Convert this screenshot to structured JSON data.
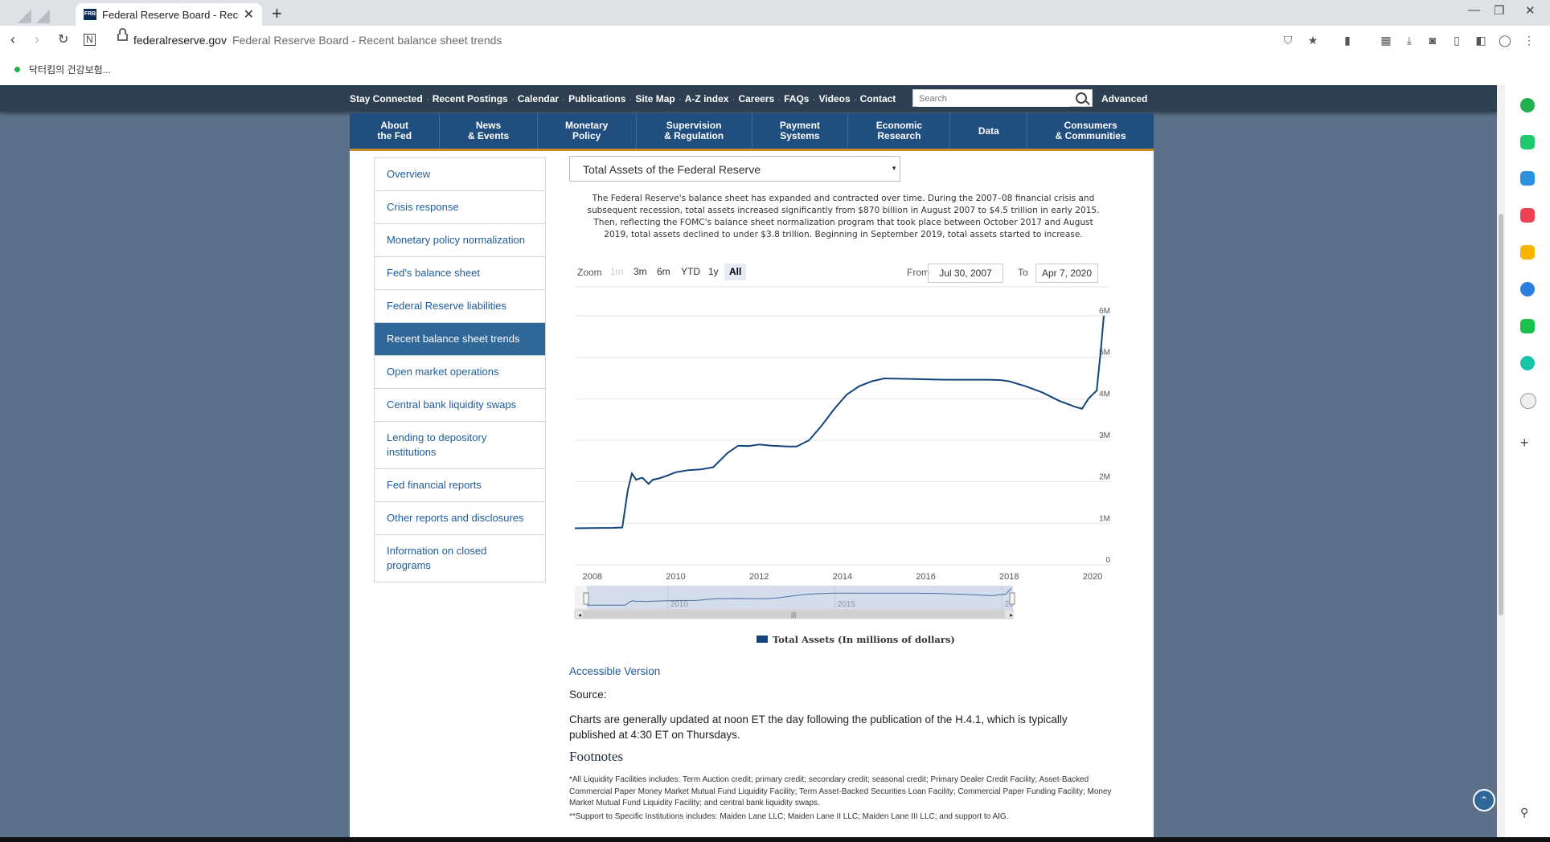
{
  "browser": {
    "tab_title": "Federal Reserve Board - Recent",
    "favicon_text": "FRB",
    "url_host": "federalreserve.gov",
    "url_page_title": "Federal Reserve Board - Recent balance sheet trends",
    "bookmark": "닥터킴의 건강보험..."
  },
  "util_nav": {
    "links": [
      "Stay Connected",
      "Recent Postings",
      "Calendar",
      "Publications",
      "Site Map",
      "A-Z index",
      "Careers",
      "FAQs",
      "Videos",
      "Contact"
    ],
    "search_placeholder": "Search",
    "advanced": "Advanced"
  },
  "main_nav": [
    {
      "line1": "About",
      "line2": "the Fed"
    },
    {
      "line1": "News",
      "line2": "& Events"
    },
    {
      "line1": "Monetary",
      "line2": "Policy"
    },
    {
      "line1": "Supervision",
      "line2": "& Regulation"
    },
    {
      "line1": "Payment",
      "line2": "Systems"
    },
    {
      "line1": "Economic",
      "line2": "Research"
    },
    {
      "line1": "Data",
      "line2": ""
    },
    {
      "line1": "Consumers",
      "line2": "& Communities"
    }
  ],
  "sidebar": [
    "Overview",
    "Crisis response",
    "Monetary policy normalization",
    "Fed's balance sheet",
    "Federal Reserve liabilities",
    "Recent balance sheet trends",
    "Open market operations",
    "Central bank liquidity swaps",
    "Lending to depository institutions",
    "Fed financial reports",
    "Other reports and disclosures",
    "Information on closed programs"
  ],
  "sidebar_active_index": 5,
  "dataset_selected": "Total Assets of the Federal Reserve",
  "intro": "The Federal Reserve's balance sheet has expanded and contracted over time. During the 2007–08 financial crisis and subsequent recession, total assets increased significantly from $870 billion in August 2007 to $4.5 trillion in early 2015. Then, reflecting the FOMC's balance sheet normalization program that took place between October 2017 and August 2019, total assets declined to under $3.8 trillion. Beginning in September 2019, total assets started to increase.",
  "zoom": {
    "label": "Zoom",
    "buttons": [
      "1m",
      "3m",
      "6m",
      "YTD",
      "1y",
      "All"
    ],
    "disabled": "1m",
    "active": "All"
  },
  "range": {
    "from_label": "From",
    "from": "Jul 30, 2007",
    "to_label": "To",
    "to": "Apr 7, 2020"
  },
  "chart_data": {
    "type": "line",
    "series": [
      {
        "name": "Total Assets (In millions of dollars)",
        "x": [
          2007.58,
          2008.0,
          2008.5,
          2008.72,
          2008.85,
          2008.95,
          2009.05,
          2009.2,
          2009.35,
          2009.45,
          2009.6,
          2009.8,
          2010.0,
          2010.3,
          2010.6,
          2010.9,
          2011.25,
          2011.5,
          2011.75,
          2012.0,
          2012.3,
          2012.7,
          2012.9,
          2013.2,
          2013.5,
          2013.8,
          2014.1,
          2014.4,
          2014.7,
          2015.0,
          2015.5,
          2016.0,
          2016.5,
          2017.0,
          2017.5,
          2017.8,
          2018.0,
          2018.4,
          2018.8,
          2019.2,
          2019.6,
          2019.75,
          2019.9,
          2020.1,
          2020.2,
          2020.27
        ],
        "y": [
          880000,
          885000,
          890000,
          900000,
          1800000,
          2200000,
          2050000,
          2100000,
          1950000,
          2050000,
          2080000,
          2150000,
          2230000,
          2280000,
          2300000,
          2350000,
          2700000,
          2870000,
          2860000,
          2900000,
          2870000,
          2850000,
          2850000,
          3000000,
          3350000,
          3750000,
          4100000,
          4300000,
          4420000,
          4490000,
          4480000,
          4470000,
          4460000,
          4460000,
          4460000,
          4450000,
          4420000,
          4300000,
          4150000,
          3950000,
          3800000,
          3760000,
          4000000,
          4200000,
          5200000,
          6000000
        ]
      }
    ],
    "x_ticks": [
      "2008",
      "2010",
      "2012",
      "2014",
      "2016",
      "2018",
      "2020"
    ],
    "y_ticks": [
      "0",
      "1M",
      "2M",
      "3M",
      "4M",
      "5M",
      "6M"
    ],
    "xlim": [
      2007.58,
      2020.27
    ],
    "ylim": [
      0,
      6000000
    ],
    "navigator_labels": [
      "2010",
      "2015",
      "20"
    ],
    "legend": "Total Assets (In millions of dollars)",
    "colors": {
      "line": "#13447c",
      "grid": "#e6e6e6",
      "navigator_fill": "#d4ddeb"
    }
  },
  "accessible_version": "Accessible Version",
  "source": "Source:",
  "charts_note": "Charts are generally updated at noon ET the day following the publication of the H.4.1, which is typically published at 4:30 ET on Thursdays.",
  "footnotes_heading": "Footnotes",
  "footnotes": [
    "*All Liquidity Facilities includes: Term Auction credit; primary credit; secondary credit; seasonal credit; Primary Dealer Credit Facility; Asset-Backed Commercial Paper Money Market Mutual Fund Liquidity Facility; Term Asset-Backed Securities Loan Facility; Commercial Paper Funding Facility; Money Market Mutual Fund Liquidity Facility; and central bank liquidity swaps.",
    "**Support to Specific Institutions includes: Maiden Lane LLC; Maiden Lane II LLC; Maiden Lane III LLC; and support to AIG."
  ],
  "icons": {
    "back": "back-arrow-icon",
    "forward": "forward-arrow-icon",
    "reload": "reload-icon",
    "lock": "lock-icon",
    "search": "search-icon",
    "back_to_top": "chevron-up-icon"
  }
}
